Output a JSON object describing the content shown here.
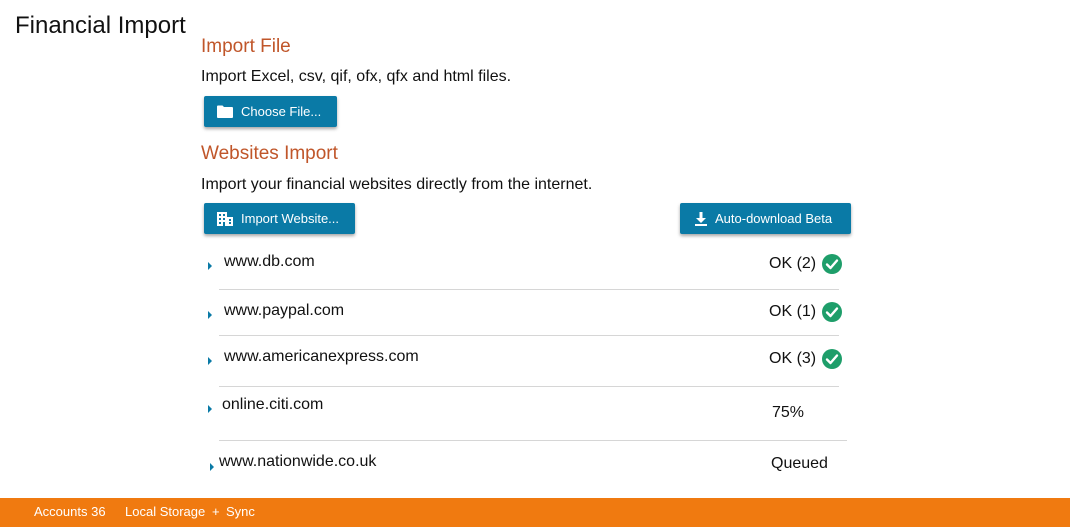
{
  "app": {
    "title": "Financial Import"
  },
  "import_file": {
    "heading": "Import File",
    "description": "Import Excel, csv, qif, ofx, qfx and html files.",
    "choose_button": "Choose File..."
  },
  "websites_import": {
    "heading": "Websites Import",
    "description": "Import your financial websites directly from the internet.",
    "import_button": "Import Website...",
    "auto_download_button": "Auto-download Beta"
  },
  "sites": [
    {
      "url": "www.db.com",
      "status": "OK (2)",
      "ok": true
    },
    {
      "url": "www.paypal.com",
      "status": "OK (1)",
      "ok": true
    },
    {
      "url": "www.americanexpress.com",
      "status": "OK (3)",
      "ok": true
    },
    {
      "url": "online.citi.com",
      "status": "75%",
      "ok": false
    },
    {
      "url": "www.nationwide.co.uk",
      "status": "Queued",
      "ok": false
    }
  ],
  "footer": {
    "accounts": "Accounts 36",
    "storage": "Local Storage",
    "plus": "+",
    "sync": "Sync"
  },
  "colors": {
    "accent": "#0a7aa6",
    "heading": "#c0562a",
    "footer": "#f07a10",
    "ok_green": "#1e9e6a"
  },
  "icons": {
    "choose_button": "folder-icon",
    "import_button": "building-icon",
    "auto_download_button": "download-icon",
    "status_ok": "check-circle-icon",
    "row_toggle": "caret-right-icon"
  }
}
